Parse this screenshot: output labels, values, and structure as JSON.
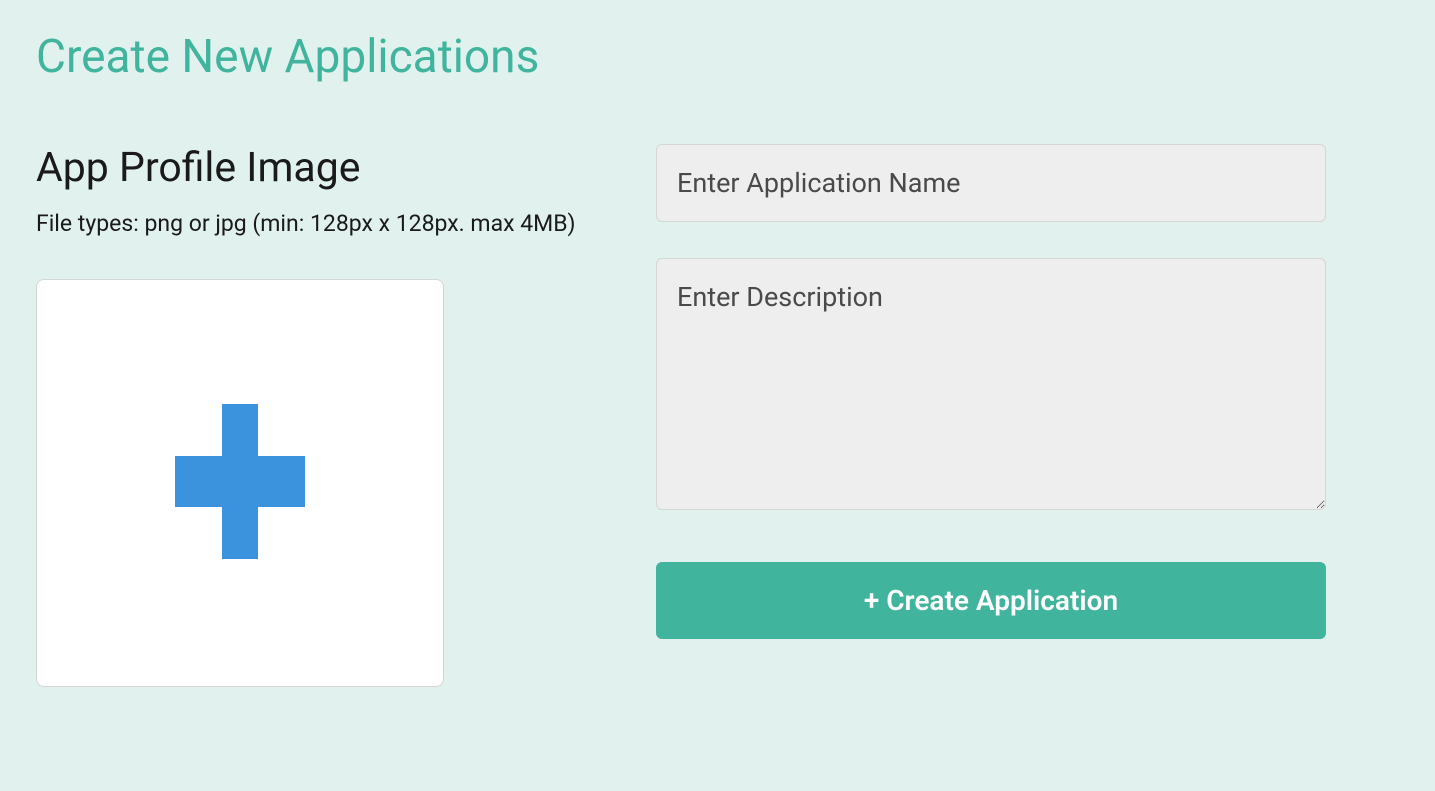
{
  "page": {
    "title": "Create New Applications"
  },
  "image_section": {
    "heading": "App Profile Image",
    "hint": "File types: png or jpg (min: 128px x 128px. max 4MB)"
  },
  "form": {
    "name_placeholder": "Enter Application Name",
    "name_value": "",
    "description_placeholder": "Enter Description",
    "description_value": "",
    "submit_label": "+ Create Application"
  },
  "colors": {
    "accent": "#40b49c",
    "plus_icon": "#3c93dd",
    "background": "#e1f1ee",
    "input_background": "#eeeeee"
  }
}
